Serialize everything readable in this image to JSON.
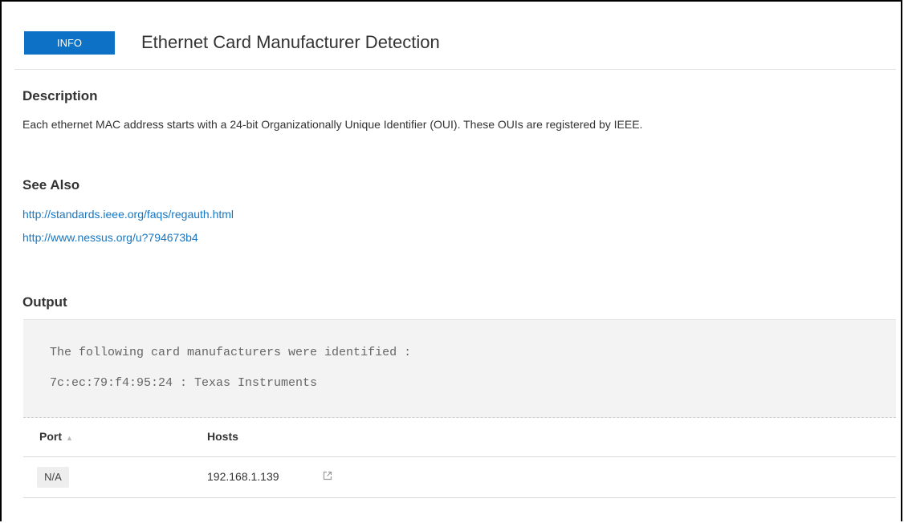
{
  "header": {
    "badge": "INFO",
    "title": "Ethernet Card Manufacturer Detection"
  },
  "description": {
    "heading": "Description",
    "text": "Each ethernet MAC address starts with a 24-bit Organizationally Unique Identifier (OUI). These OUIs are registered by IEEE."
  },
  "see_also": {
    "heading": "See Also",
    "links": [
      "http://standards.ieee.org/faqs/regauth.html",
      "http://www.nessus.org/u?794673b4"
    ]
  },
  "output": {
    "heading": "Output",
    "lines": [
      "The following card manufacturers were identified :",
      "7c:ec:79:f4:95:24 : Texas Instruments"
    ]
  },
  "table": {
    "columns": [
      "Port",
      "Hosts"
    ],
    "sort_icon": "sort-up-icon",
    "rows": [
      {
        "port": "N/A",
        "host": "192.168.1.139"
      }
    ]
  },
  "colors": {
    "badge": "#0d71c5",
    "link": "#1777c2"
  }
}
